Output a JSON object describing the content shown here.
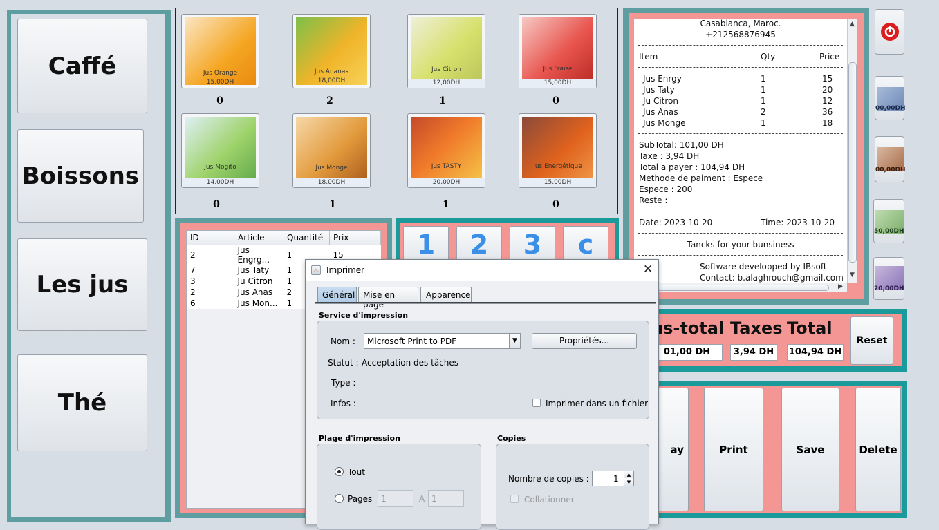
{
  "categories": [
    "Caffé",
    "Boissons",
    "Les jus",
    "Thé"
  ],
  "products": [
    {
      "name": "Jus Orange",
      "price": "15,00DH",
      "count": "0",
      "color": "#f5a623"
    },
    {
      "name": "Jus Ananas",
      "price": "18,00DH",
      "count": "2",
      "color": "#f0b429"
    },
    {
      "name": "Jus Citron",
      "price": "12,00DH",
      "count": "1",
      "color": "#d7e06b"
    },
    {
      "name": "Jus Fraise",
      "price": "15,00DH",
      "count": "0",
      "color": "#e8554e"
    },
    {
      "name": "Jus Mogito",
      "price": "14,00DH",
      "count": "0",
      "color": "#9fd36b"
    },
    {
      "name": "Jus Monge",
      "price": "18,00DH",
      "count": "1",
      "color": "#e29a3c"
    },
    {
      "name": "Jus TASTY",
      "price": "20,00DH",
      "count": "1",
      "color": "#f07a2a"
    },
    {
      "name": "Jus Energétique",
      "price": "15,00DH",
      "count": "0",
      "color": "#e0621d"
    }
  ],
  "order_table": {
    "headers": [
      "ID",
      "Article",
      "Quantité",
      "Prix"
    ],
    "rows": [
      [
        "2",
        "Jus Engrg...",
        "1",
        "15"
      ],
      [
        "7",
        "Jus Taty",
        "1",
        ""
      ],
      [
        "3",
        "Ju Citron",
        "1",
        ""
      ],
      [
        "2",
        "Jus Anas",
        "2",
        ""
      ],
      [
        "6",
        "Jus Mon...",
        "1",
        ""
      ]
    ]
  },
  "keypad": [
    "1",
    "2",
    "3",
    "c"
  ],
  "receipt": {
    "address": "Casablanca, Maroc.",
    "phone": "+212568876945",
    "col_item": "Item",
    "col_qty": "Qty",
    "col_price": "Price",
    "items": [
      {
        "name": "Jus Enrgy",
        "qty": "1",
        "price": "15"
      },
      {
        "name": "Jus Taty",
        "qty": "1",
        "price": "20"
      },
      {
        "name": "Ju Citron",
        "qty": "1",
        "price": "12"
      },
      {
        "name": "Jus Anas",
        "qty": "2",
        "price": "36"
      },
      {
        "name": "Jus Monge",
        "qty": "1",
        "price": "18"
      }
    ],
    "subtotal": "SubTotal: 101,00 DH",
    "taxe": "Taxe  : 3,94 DH",
    "total": "Total a payer   : 104,94 DH",
    "methode": "Methode de paiment  : Espece",
    "espece": "Espece  : 200",
    "reste": "Reste   :",
    "date": "Date: 2023-10-20",
    "time": "Time: 2023-10-20",
    "thanks": "Tancks for your bunsiness",
    "software": "Software developped by IBsoft",
    "contact": "Contact: b.alaghrouch@gmail.com"
  },
  "bills": [
    "00,00DH",
    "00,00DH",
    "50,00DH",
    "20,00DH"
  ],
  "totals": {
    "subtotal_label": "us-total",
    "taxes_label": "Taxes",
    "total_label": "Total",
    "subtotal_value": "01,00 DH",
    "taxes_value": "3,94 DH",
    "total_value": "104,94 DH",
    "reset_label": "Reset"
  },
  "actions": {
    "pay_partial": "ay",
    "print": "Print",
    "save": "Save",
    "delete": "Delete"
  },
  "dialog": {
    "title": "Imprimer",
    "tabs": [
      "Général",
      "Mise en page",
      "Apparence"
    ],
    "service_title": "Service d'impression",
    "nom_label": "Nom :",
    "printer": "Microsoft Print to PDF",
    "proprietes": "Propriétés...",
    "statut_label": "Statut :",
    "statut_value": "Acceptation des tâches",
    "type_label": "Type :",
    "infos_label": "Infos :",
    "print_to_file": "Imprimer dans un fichier",
    "plage_title": "Plage d'impression",
    "tout": "Tout",
    "pages": "Pages",
    "page_from": "1",
    "page_sep": "A",
    "page_to": "1",
    "copies_title": "Copies",
    "nb_copies_label": "Nombre de copies :",
    "nb_copies": "1",
    "collationner": "Collationner"
  }
}
